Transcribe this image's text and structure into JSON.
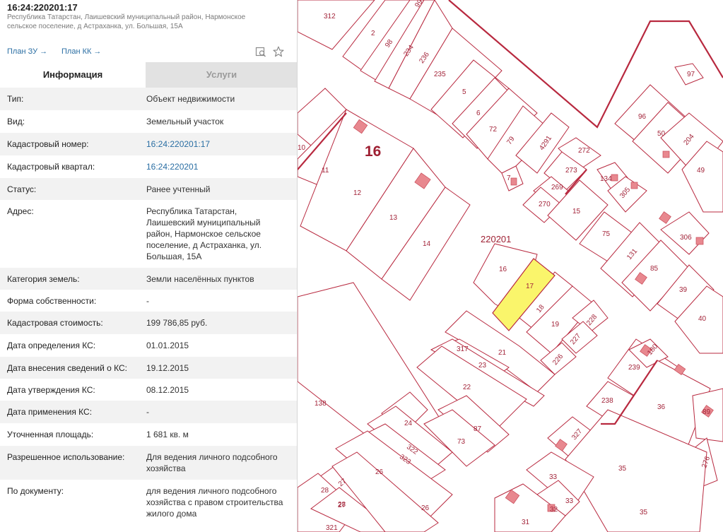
{
  "header": {
    "cadastral_title": "16:24:220201:17",
    "address": "Республика Татарстан, Лаишевский муниципальный район, Нармонское сельское поселение, д Астраханка, ул. Большая, 15А"
  },
  "links": {
    "plan_zu": "План ЗУ",
    "plan_kk": "План КК",
    "arrow": "→"
  },
  "icons": {
    "map_search": "map-search-icon",
    "favorite": "star-icon"
  },
  "tabs": {
    "info": "Информация",
    "services": "Услуги"
  },
  "rows": [
    {
      "key": "Тип:",
      "value": "Объект недвижимости"
    },
    {
      "key": "Вид:",
      "value": "Земельный участок"
    },
    {
      "key": "Кадастровый номер:",
      "value": "16:24:220201:17"
    },
    {
      "key": "Кадастровый квартал:",
      "value": "16:24:220201"
    },
    {
      "key": "Статус:",
      "value": "Ранее учтенный"
    },
    {
      "key": "Адрес:",
      "value": "Республика Татарстан, Лаишевский муниципальный район, Нармонское сельское поселение, д Астраханка, ул. Большая, 15А"
    },
    {
      "key": "Категория земель:",
      "value": "Земли населённых пунктов"
    },
    {
      "key": "Форма собственности:",
      "value": "-"
    },
    {
      "key": "Кадастровая стоимость:",
      "value": "199 786,85 руб."
    },
    {
      "key": "Дата определения КС:",
      "value": "01.01.2015"
    },
    {
      "key": "Дата внесения сведений о КС:",
      "value": "19.12.2015"
    },
    {
      "key": "Дата утверждения КС:",
      "value": "08.12.2015"
    },
    {
      "key": "Дата применения КС:",
      "value": "-"
    },
    {
      "key": "Уточненная площадь:",
      "value": "1 681 кв. м"
    },
    {
      "key": "Разрешенное использование:",
      "value": "Для ведения личного подсобного хозяйства"
    },
    {
      "key": "По документу:",
      "value": "для ведения личного подсобного хозяйства с правом строительства жилого дома"
    }
  ],
  "map": {
    "colors": {
      "boundary": "#b8293f",
      "selected": "#faf56b",
      "building": "#e8888f"
    },
    "district_label": "16",
    "quarter_label": "220201",
    "selected_parcel": "17",
    "parcel_labels": [
      "312",
      "2",
      "98",
      "234",
      "236",
      "99",
      "235",
      "5",
      "6",
      "72",
      "79",
      "4291",
      "7",
      "272",
      "273",
      "269",
      "270",
      "15",
      "134",
      "305",
      "97",
      "96",
      "50",
      "204",
      "49",
      "10",
      "11",
      "12",
      "13",
      "14",
      "75",
      "131",
      "85",
      "306",
      "39",
      "40",
      "16",
      "17",
      "18",
      "19",
      "228",
      "227",
      "226",
      "21",
      "317",
      "23",
      "22",
      "239",
      "180",
      "238",
      "36",
      "138",
      "24",
      "87",
      "73",
      "322",
      "323",
      "26",
      "327",
      "35",
      "89",
      "276",
      "28",
      "27",
      "33",
      "32",
      "31",
      "321"
    ]
  }
}
